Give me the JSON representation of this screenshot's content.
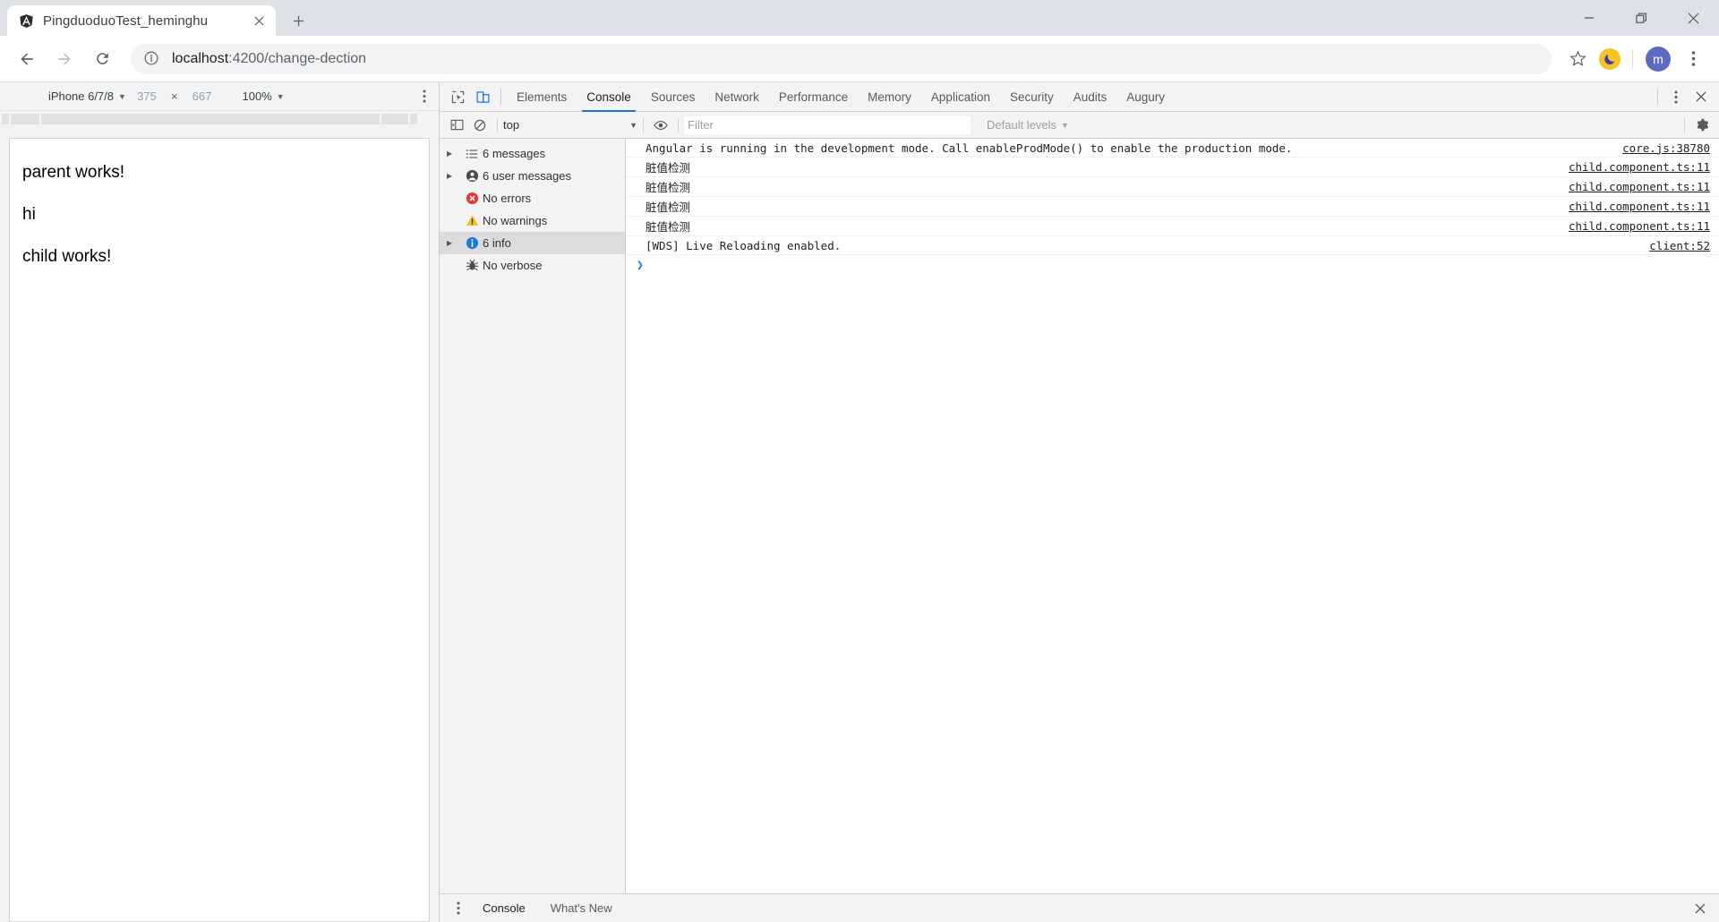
{
  "browser": {
    "tab": {
      "title": "PingduoduoTest_heminghu",
      "favicon": "angular-logo-icon",
      "close": "×"
    },
    "new_tab_label": "+",
    "window_controls": {
      "minimize": "minimize-icon",
      "maximize": "maximize-icon",
      "close": "close-icon"
    },
    "nav": {
      "back": "back-arrow-icon",
      "forward": "forward-arrow-icon",
      "reload": "reload-icon"
    },
    "omnibox": {
      "info_icon": "page-info-icon",
      "host": "localhost",
      "path": ":4200/change-dection"
    },
    "toolbar_right": {
      "bookmark": "star-icon",
      "extension": "moon-extension-icon",
      "avatar_letter": "m",
      "menu": "kebab-menu-icon"
    }
  },
  "device_toolbar": {
    "device": "iPhone 6/7/8",
    "caret": "▼",
    "width": "375",
    "x": "×",
    "height": "667",
    "zoom": "100%",
    "kebab": "kebab-menu-icon"
  },
  "page": {
    "lines": [
      "parent works!",
      "hi",
      "child works!"
    ]
  },
  "devtools": {
    "icons": {
      "inspect": "inspect-element-icon",
      "device": "toggle-device-toolbar-icon",
      "kebab": "kebab-menu-icon",
      "close": "close-icon",
      "settings": "gear-icon"
    },
    "tabs": [
      {
        "label": "Elements",
        "selected": false
      },
      {
        "label": "Console",
        "selected": true
      },
      {
        "label": "Sources",
        "selected": false
      },
      {
        "label": "Network",
        "selected": false
      },
      {
        "label": "Performance",
        "selected": false
      },
      {
        "label": "Memory",
        "selected": false
      },
      {
        "label": "Application",
        "selected": false
      },
      {
        "label": "Security",
        "selected": false
      },
      {
        "label": "Audits",
        "selected": false
      },
      {
        "label": "Augury",
        "selected": false
      }
    ],
    "filterbar": {
      "sidebar_toggle_icon": "console-sidebar-toggle-icon",
      "clear_icon": "clear-console-icon",
      "context": "top",
      "context_caret": "▼",
      "eye_icon": "live-expression-eye-icon",
      "filter_value": "",
      "filter_placeholder": "Filter",
      "levels": "Default levels",
      "levels_caret": "▼"
    },
    "sidebar": [
      {
        "label": "6 messages",
        "icon": "list-icon",
        "arrow": "▶",
        "selected": false
      },
      {
        "label": "6 user messages",
        "icon": "user-icon",
        "arrow": "▶",
        "selected": false
      },
      {
        "label": "No errors",
        "icon": "error-icon",
        "arrow": "",
        "selected": false
      },
      {
        "label": "No warnings",
        "icon": "warning-icon",
        "arrow": "",
        "selected": false
      },
      {
        "label": "6 info",
        "icon": "info-icon",
        "arrow": "▶",
        "selected": true
      },
      {
        "label": "No verbose",
        "icon": "verbose-bug-icon",
        "arrow": "",
        "selected": false
      }
    ],
    "messages": [
      {
        "text": "Angular is running in the development mode. Call enableProdMode() to enable the production mode.",
        "source": "core.js:38780"
      },
      {
        "text": "脏值检测",
        "source": "child.component.ts:11"
      },
      {
        "text": "脏值检测",
        "source": "child.component.ts:11"
      },
      {
        "text": "脏值检测",
        "source": "child.component.ts:11"
      },
      {
        "text": "脏值检测",
        "source": "child.component.ts:11"
      },
      {
        "text": "[WDS] Live Reloading enabled.",
        "source": "client:52"
      }
    ],
    "prompt_symbol": "❯",
    "drawer": {
      "kebab": "kebab-menu-icon",
      "tabs": [
        {
          "label": "Console",
          "selected": true
        },
        {
          "label": "What's New",
          "selected": false
        }
      ],
      "close": "close-icon"
    }
  },
  "colors": {
    "accent": "#1a73e8",
    "error": "#e53935",
    "warning": "#f5c026",
    "info": "#1a73e8",
    "tabstrip": "#dee1e6",
    "devtools_bg": "#f3f3f3"
  }
}
